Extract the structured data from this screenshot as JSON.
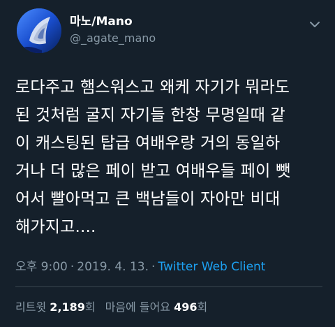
{
  "tweet": {
    "author": {
      "display_name": "마노/Mano",
      "handle": "@_agate_mano",
      "avatar_icon": "agate-avatar-icon"
    },
    "menu_icon": "chevron-down-icon",
    "text_lines": [
      "로다주고 햄스워스고 왜케 자기가 뭐라도",
      "된 것처럼 굴지 자기들 한창 무명일때 같",
      "이 캐스팅된 탑급 여배우랑 거의 동일하",
      "거나 더 많은 페이 받고 여배우들 페이 뺏",
      "어서 빨아먹고 큰 백남들이 자아만 비대",
      "해가지고...."
    ],
    "time": "오후 9:00",
    "separator": "·",
    "date": "2019. 4. 13.",
    "source": "Twitter Web Client",
    "retweets_label": "리트윗",
    "retweets_count": "2,189",
    "retweets_suffix": "회",
    "likes_label": "마음에 들어요",
    "likes_count": "496",
    "likes_suffix": "회"
  },
  "colors": {
    "background": "#15202b",
    "text": "#ffffff",
    "secondary": "#8899a6",
    "link": "#1da1f2",
    "divider": "#38444d"
  }
}
